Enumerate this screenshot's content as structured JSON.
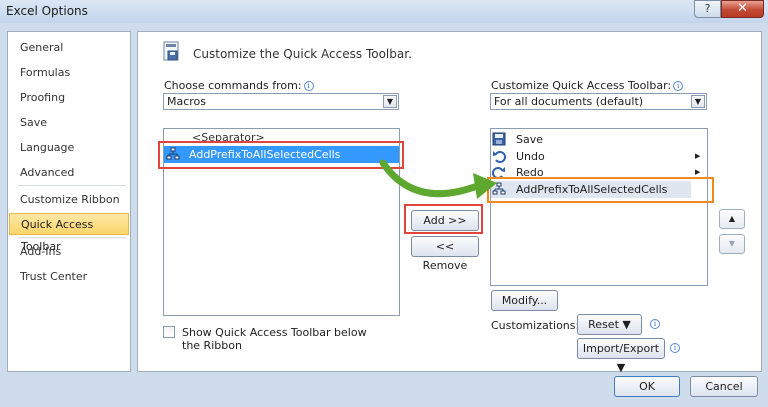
{
  "window": {
    "title": "Excel Options",
    "help_label": "?",
    "close_label": "✕"
  },
  "nav": {
    "items": [
      {
        "label": "General"
      },
      {
        "label": "Formulas"
      },
      {
        "label": "Proofing"
      },
      {
        "label": "Save"
      },
      {
        "label": "Language"
      },
      {
        "label": "Advanced"
      },
      {
        "label": "Customize Ribbon"
      },
      {
        "label": "Quick Access Toolbar",
        "active": true
      },
      {
        "label": "Add-Ins"
      },
      {
        "label": "Trust Center"
      }
    ]
  },
  "main": {
    "heading": "Customize the Quick Access Toolbar.",
    "choose": {
      "label": "Choose commands from:",
      "value": "Macros"
    },
    "customize": {
      "label": "Customize Quick Access Toolbar:",
      "value": "For all documents (default)"
    },
    "left_list": {
      "items": [
        "<Separator>",
        "AddPrefixToAllSelectedCells"
      ]
    },
    "right_list": {
      "items": [
        "Save",
        "Undo",
        "Redo",
        "AddPrefixToAllSelectedCells"
      ]
    },
    "add_label": "Add >>",
    "remove_label": "<< Remove",
    "modify_label": "Modify...",
    "customizations_label": "Customizations:",
    "reset_label": "Reset ▼",
    "import_export_label": "Import/Export ▼",
    "show_below_label": "Show Quick Access Toolbar below the Ribbon",
    "move_up_icon": "up-triangle-icon",
    "move_down_icon": "down-triangle-icon"
  },
  "footer": {
    "ok_label": "OK",
    "cancel_label": "Cancel"
  },
  "colors": {
    "selection": "#3399ff",
    "active_nav": "#fbd56a",
    "highlight_red": "#e0443a",
    "highlight_orange": "#f08a1e",
    "arrow_green": "#5fa830"
  }
}
